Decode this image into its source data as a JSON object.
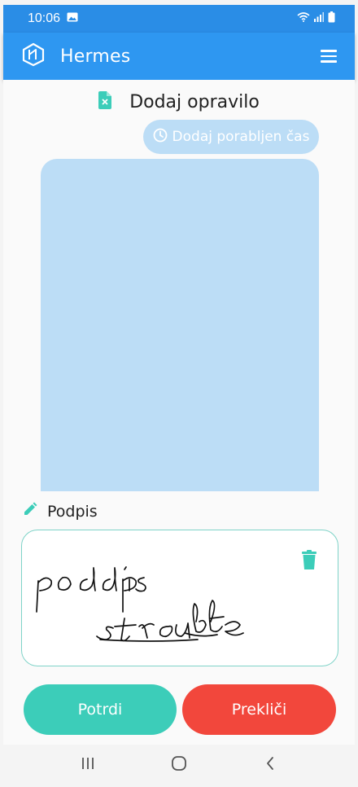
{
  "status_bar": {
    "time": "10:06",
    "icons": [
      "image-icon",
      "wifi-icon",
      "signal-icon",
      "battery-icon"
    ]
  },
  "app_bar": {
    "title": "Hermes",
    "logo_icon": "hermes-logo-icon",
    "menu_icon": "hamburger-menu-icon"
  },
  "page": {
    "title": "Dodaj opravilo",
    "title_icon": "document-icon"
  },
  "time_button": {
    "label": "Dodaj porabljen čas",
    "icon": "clock-icon"
  },
  "signature": {
    "label": "Podpis",
    "label_icon": "pencil-icon",
    "delete_icon": "trash-icon"
  },
  "actions": {
    "confirm_label": "Potrdi",
    "cancel_label": "Prekliči"
  },
  "nav": {
    "icons": [
      "recent-apps-icon",
      "home-icon",
      "back-icon"
    ]
  },
  "colors": {
    "primary": "#2e97f1",
    "status_bar": "#2a8de6",
    "light_blue": "#bcddf6",
    "teal": "#3ccdb9",
    "red": "#f2473c",
    "signature_border": "#7fd3c8"
  }
}
